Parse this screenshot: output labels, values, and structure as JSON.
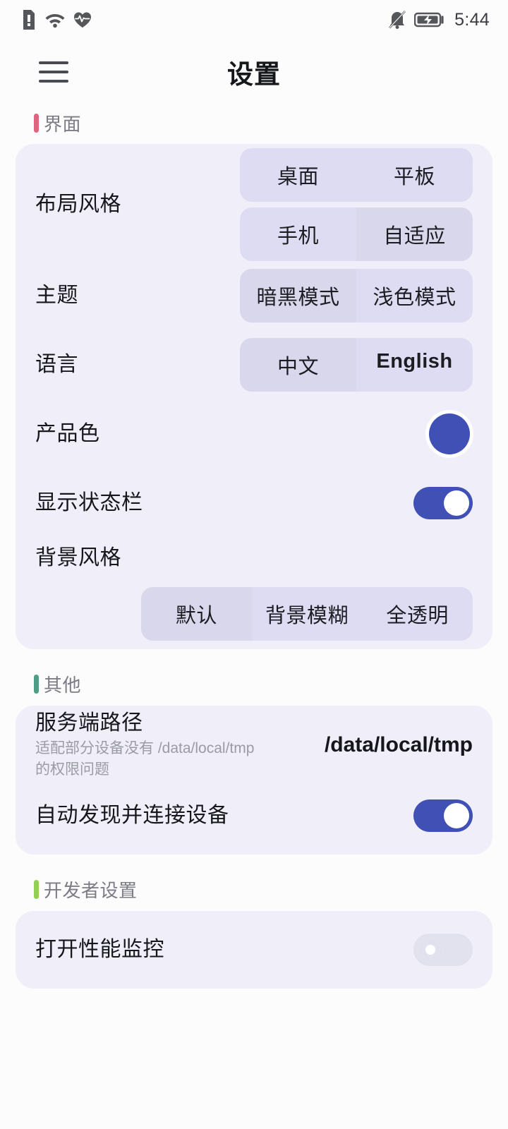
{
  "status_bar": {
    "left_icons": [
      "sim-card-alert-icon",
      "wifi-icon",
      "heart-rate-icon"
    ],
    "right_icons": [
      "bell-muted-icon",
      "battery-charging-icon"
    ],
    "time": "5:44"
  },
  "app_bar": {
    "menu_icon": "hamburger-menu-icon",
    "title": "设置"
  },
  "sections": [
    {
      "id": "interface",
      "title": "界面",
      "accent": "#e0647f"
    },
    {
      "id": "other",
      "title": "其他",
      "accent": "#4e9e86"
    },
    {
      "id": "developer",
      "title": "开发者设置",
      "accent": "#92d050"
    }
  ],
  "interface": {
    "layout_style": {
      "label": "布局风格",
      "options": [
        "桌面",
        "平板",
        "手机",
        "自适应"
      ],
      "selected": "自适应"
    },
    "theme": {
      "label": "主题",
      "options": [
        "暗黑模式",
        "浅色模式"
      ],
      "selected": "暗黑模式"
    },
    "language": {
      "label": "语言",
      "options": [
        "中文",
        "English"
      ],
      "selected": "中文"
    },
    "product_color": {
      "label": "产品色",
      "value": "#4050b5"
    },
    "show_status_bar": {
      "label": "显示状态栏",
      "enabled": true
    },
    "background_style": {
      "label": "背景风格",
      "options": [
        "默认",
        "背景模糊",
        "全透明"
      ],
      "selected": "默认"
    }
  },
  "other": {
    "server_path": {
      "label": "服务端路径",
      "sub": "适配部分设备没有 /data/local/tmp 的权限问题",
      "value": "/data/local/tmp"
    },
    "auto_discover": {
      "label": "自动发现并连接设备",
      "enabled": true
    }
  },
  "developer": {
    "performance_monitor": {
      "label": "打开性能监控",
      "enabled": false
    }
  }
}
